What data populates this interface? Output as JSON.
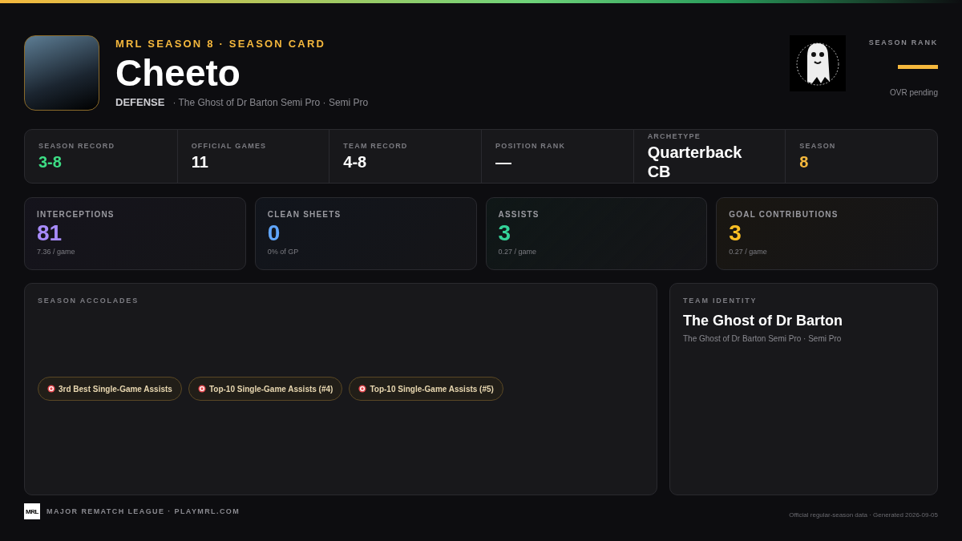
{
  "header": {
    "eyebrow": "MRL SEASON 8 · SEASON CARD",
    "player_name": "Cheeto",
    "position": "DEFENSE",
    "team_line": "· The Ghost of Dr Barton Semi Pro · Semi Pro",
    "rank_label": "SEASON RANK",
    "rank_note": "OVR pending"
  },
  "info_strip": [
    {
      "label": "SEASON RECORD",
      "value": "3-8",
      "color": "#3ddc84"
    },
    {
      "label": "OFFICIAL GAMES",
      "value": "11",
      "color": "#ffffff"
    },
    {
      "label": "TEAM RECORD",
      "value": "4-8",
      "color": "#ffffff"
    },
    {
      "label": "POSITION RANK",
      "value": "—",
      "color": "#ffffff"
    },
    {
      "label": "ARCHETYPE",
      "value": "Quarterback CB",
      "color": "#ffffff"
    },
    {
      "label": "SEASON",
      "value": "8",
      "color": "#f5b83d"
    }
  ],
  "stats": [
    {
      "label": "INTERCEPTIONS",
      "value": "81",
      "sub": "7.36 / game",
      "color": "#a78bfa"
    },
    {
      "label": "CLEAN SHEETS",
      "value": "0",
      "sub": "0% of GP",
      "color": "#60a5fa"
    },
    {
      "label": "ASSISTS",
      "value": "3",
      "sub": "0.27 / game",
      "color": "#34d399"
    },
    {
      "label": "GOAL CONTRIBUTIONS",
      "value": "3",
      "sub": "0.27 / game",
      "color": "#fbbf24"
    }
  ],
  "accolades": {
    "title": "SEASON ACCOLADES",
    "items": [
      "3rd Best Single-Game Assists",
      "Top-10 Single-Game Assists (#4)",
      "Top-10 Single-Game Assists (#5)"
    ]
  },
  "team_identity": {
    "title": "TEAM IDENTITY",
    "name": "The Ghost of Dr Barton",
    "sub": "The Ghost of Dr Barton Semi Pro · Semi Pro"
  },
  "footer": {
    "logo_text": "MRL",
    "brand": "MAJOR REMATCH LEAGUE · PLAYMRL.COM",
    "note": "Official regular-season data · Generated 2026-09-05"
  }
}
